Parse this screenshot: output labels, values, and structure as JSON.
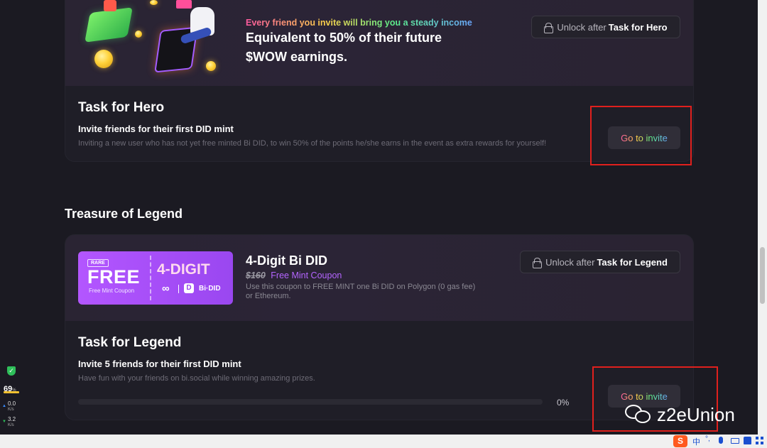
{
  "hero_card": {
    "invite_income": "Every friend you invite will bring you a steady income",
    "headline_line1": "Equivalent to 50% of their future",
    "headline_line2": "$WOW earnings.",
    "unlock_prefix": "Unlock after",
    "unlock_target": "Task for Hero",
    "task_title": "Task for Hero",
    "task_subtitle": "Invite friends for their first DID mint",
    "task_desc": "Inviting a new user who has not yet free minted Bi DID, to win 50% of the points he/she earns in the event as extra rewards for yourself!",
    "button_label": "Go to invite"
  },
  "legend_section": {
    "heading": "Treasure of Legend",
    "coupon": {
      "rare_badge": "RARE",
      "free": "FREE",
      "free_sub": "Free Mint Coupon",
      "digit": "4-DIGIT",
      "brand": "Bi·DID"
    },
    "title": "4-Digit Bi DID",
    "old_price": "$160",
    "coupon_label": "Free Mint Coupon",
    "desc_line1": "Use this coupon to FREE MINT one Bi DID on Polygon (0 gas fee)",
    "desc_line2": "or Ethereum.",
    "unlock_prefix": "Unlock after",
    "unlock_target": "Task for Legend",
    "task_title": "Task for Legend",
    "task_subtitle": "Invite 5 friends for their first DID mint",
    "task_desc": "Have fun with your friends on bi.social while winning amazing prizes.",
    "progress_label": "0%",
    "progress_value": 0,
    "button_label": "Go to invite"
  },
  "overlay": {
    "percent": "69",
    "percent_unit": "%",
    "up_speed": "0.0",
    "up_unit": "K/s",
    "down_speed": "3.2",
    "down_unit": "K/s",
    "watermark": "z2eUnion"
  },
  "taskbar": {
    "ime_label": "中"
  }
}
